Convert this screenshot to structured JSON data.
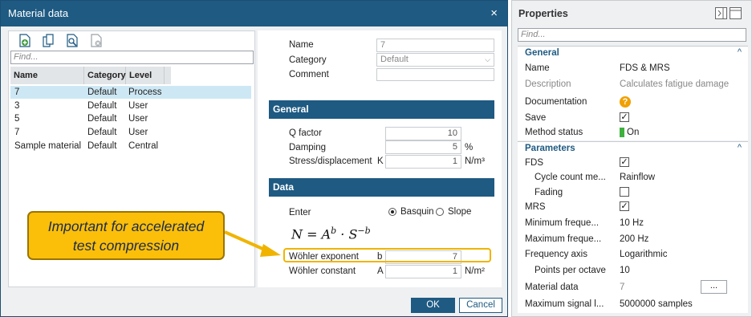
{
  "dialog": {
    "title": "Material data",
    "close_glyph": "×",
    "toolbar_icons": [
      "add-material-icon",
      "copy-material-icon",
      "edit-material-icon",
      "delete-material-icon"
    ],
    "find_placeholder": "Find...",
    "columns": [
      "Name",
      "Category",
      "Level"
    ],
    "rows": [
      {
        "name": "7",
        "category": "Default",
        "level": "Process"
      },
      {
        "name": "3",
        "category": "Default",
        "level": "User"
      },
      {
        "name": "5",
        "category": "Default",
        "level": "User"
      },
      {
        "name": "7",
        "category": "Default",
        "level": "User"
      },
      {
        "name": "Sample material",
        "category": "Default",
        "level": "Central"
      }
    ],
    "name_label": "Name",
    "name_value": "7",
    "category_label": "Category",
    "category_value": "Default",
    "comment_label": "Comment",
    "general_header": "General",
    "q_factor_label": "Q factor",
    "q_factor_value": "10",
    "damping_label": "Damping",
    "damping_value": "5",
    "damping_unit": "%",
    "stress_label": "Stress/displacement",
    "stress_symbol": "K",
    "stress_value": "1",
    "stress_unit": "N/m³",
    "data_header": "Data",
    "enter_label": "Enter",
    "basquin_label": "Basquin",
    "slope_label": "Slope",
    "formula": "N = A",
    "formula_exp_b": "b",
    "formula_mid": " · S",
    "formula_exp_neg_b": "−b",
    "wohler_exp_label": "Wöhler exponent",
    "wohler_exp_symbol": "b",
    "wohler_exp_value": "7",
    "wohler_const_label": "Wöhler constant",
    "wohler_const_symbol": "A",
    "wohler_const_value": "1",
    "wohler_const_unit": "N/m²",
    "ok_label": "OK",
    "cancel_label": "Cancel"
  },
  "callout": {
    "line1": "Important for accelerated",
    "line2": "test compression"
  },
  "properties": {
    "title": "Properties",
    "find_placeholder": "Find...",
    "general_header": "General",
    "name_label": "Name",
    "name_value": "FDS & MRS",
    "description_label": "Description",
    "description_value": "Calculates fatigue damage s",
    "documentation_label": "Documentation",
    "documentation_glyph": "?",
    "save_label": "Save",
    "method_status_label": "Method status",
    "method_status_value": "On",
    "parameters_header": "Parameters",
    "fds_label": "FDS",
    "cycle_count_label": "Cycle count me...",
    "cycle_count_value": "Rainflow",
    "fading_label": "Fading",
    "mrs_label": "MRS",
    "min_freq_label": "Minimum freque...",
    "min_freq_value": "10  Hz",
    "max_freq_label": "Maximum freque...",
    "max_freq_value": "200  Hz",
    "freq_axis_label": "Frequency axis",
    "freq_axis_value": "Logarithmic",
    "points_per_octave_label": "Points per octave",
    "points_per_octave_value": "10",
    "material_data_label": "Material data",
    "material_data_value": "7",
    "material_data_button": "...",
    "max_signal_label": "Maximum signal l...",
    "max_signal_value": "5000000 samples",
    "check_glyph": "✓",
    "chevron_glyph": "^",
    "status_color": "#3fb13f",
    "accent_color": "#1e5a82"
  }
}
